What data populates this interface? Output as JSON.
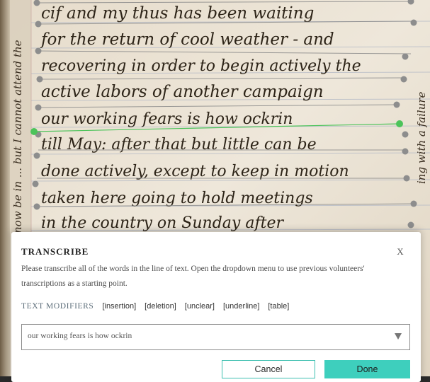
{
  "manuscript": {
    "lines": [
      "cif and my thus has been waiting",
      "for the return of cool weather - and",
      "recovering in order to begin actively the",
      "active labors of another campaign",
      "our working fears is how ockrin",
      "till May: after that but little can be",
      "done actively, except to keep in motion",
      "taken here going to hold meetings",
      "in the country on Sunday after"
    ],
    "margin_left_text": "now be in ... but I cannot attend the",
    "margin_right_text": "ing with a failure"
  },
  "modal": {
    "title": "TRANSCRIBE",
    "close_label": "X",
    "instructions": "Please transcribe all of the words in the line of text. Open the dropdown menu to use previous volunteers' transcriptions as a starting point.",
    "modifiers_label": "TEXT MODIFIERS",
    "modifiers": [
      "[insertion]",
      "[deletion]",
      "[unclear]",
      "[underline]",
      "[table]"
    ],
    "transcription_value": "our working fears is how ockrin",
    "cancel_label": "Cancel",
    "done_label": "Done"
  },
  "colors": {
    "accent": "#3ecfbd",
    "selected_line": "#4cc35a",
    "line_marker": "#8a8a8a",
    "paper": "#e9e2d4",
    "ink": "#2d2418"
  }
}
